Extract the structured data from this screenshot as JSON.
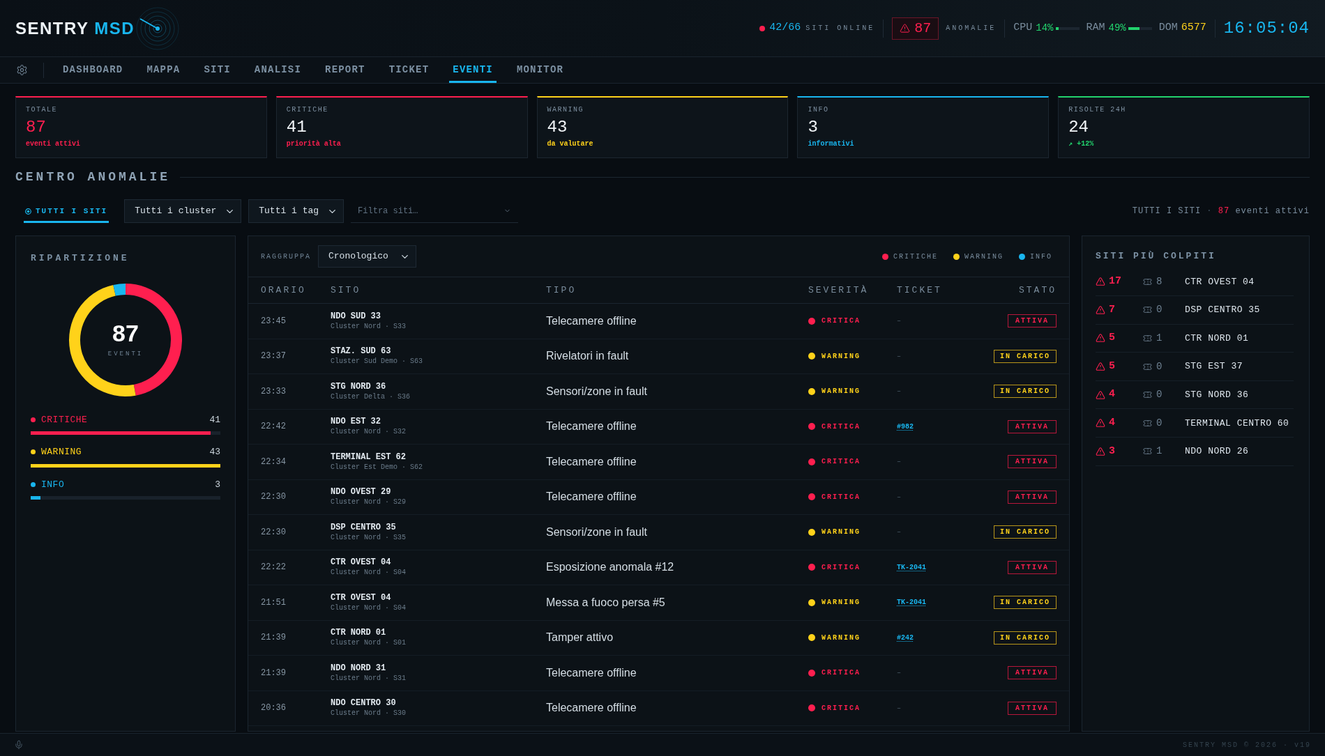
{
  "header": {
    "logo": {
      "name": "SENTRY",
      "accent": "MSD"
    },
    "sites_online": {
      "value": "42/66",
      "label": "SITI ONLINE"
    },
    "anomalies": {
      "value": "87",
      "label": "ANOMALIE"
    },
    "metrics": [
      {
        "kind": "gauge",
        "label": "CPU",
        "value": "14%",
        "level": 0.14
      },
      {
        "kind": "gauge",
        "label": "RAM",
        "value": "49%",
        "level": 0.49
      },
      {
        "kind": "count",
        "label": "DOM",
        "value": "6577"
      }
    ],
    "clock": "16:05:04"
  },
  "nav": {
    "tabs": [
      {
        "label": "DASHBOARD",
        "selected": false
      },
      {
        "label": "MAPPA",
        "selected": false
      },
      {
        "label": "SITI",
        "selected": false
      },
      {
        "label": "ANALISI",
        "selected": false
      },
      {
        "label": "REPORT",
        "selected": false
      },
      {
        "label": "TICKET",
        "selected": false
      },
      {
        "label": "EVENTI",
        "selected": true
      },
      {
        "label": "MONITOR",
        "selected": false
      }
    ]
  },
  "stat_cards": [
    {
      "kind": "total",
      "label": "TOTALE",
      "value": "87",
      "note": "eventi attivi",
      "color": "#ff1f4f"
    },
    {
      "kind": "count",
      "label": "CRITICHE",
      "value": "41",
      "note": "priorità alta",
      "color": "#ff1f4f"
    },
    {
      "kind": "count",
      "label": "WARNING",
      "value": "43",
      "note": "da valutare",
      "color": "#ffd21a"
    },
    {
      "kind": "count",
      "label": "INFO",
      "value": "3",
      "note": "informativi",
      "color": "#19b6ef"
    },
    {
      "kind": "count",
      "label": "RISOLTE 24H",
      "value": "24",
      "note": "↗ +12%",
      "color": "#22d36d"
    }
  ],
  "section_title": "CENTRO ANOMALIE",
  "filters": {
    "scope_tab": {
      "label": "TUTTI I SITI",
      "selected": true
    },
    "selects": [
      {
        "value": "Tutti i cluster"
      },
      {
        "value": "Tutti i tag"
      }
    ],
    "search": {
      "placeholder": "Filtra siti…"
    },
    "summary": {
      "scope": "TUTTI I SITI",
      "separator": "·",
      "count": "87",
      "text": "eventi attivi"
    }
  },
  "breakdown": {
    "title": "RIPARTIZIONE",
    "total": "87",
    "total_label": "EVENTI",
    "chart_data": {
      "type": "donut",
      "values": [
        47.1,
        49.4,
        3.5
      ]
    },
    "items": [
      {
        "label": "CRITICHE",
        "value": "41",
        "level": 0.95,
        "color": "#ff1f4f"
      },
      {
        "label": "WARNING",
        "value": "43",
        "level": 1.0,
        "color": "#ffd21a"
      },
      {
        "label": "INFO",
        "value": "3",
        "level": 0.05,
        "color": "#19b6ef"
      }
    ]
  },
  "events": {
    "group_label": "RAGGRUPPA",
    "group_select": "Cronologico",
    "legend": [
      {
        "label": "CRITICHE",
        "color": "#ff1f4f"
      },
      {
        "label": "WARNING",
        "color": "#ffd21a"
      },
      {
        "label": "INFO",
        "color": "#19b6ef"
      }
    ],
    "columns": [
      "ORARIO",
      "SITO",
      "TIPO",
      "SEVERITÀ",
      "TICKET",
      "STATO"
    ],
    "rows": [
      {
        "time": "23:45",
        "site": "NDO SUD 33",
        "cluster": "Cluster Nord · S33",
        "type": "Telecamere offline",
        "severity": {
          "kind": "critical",
          "label": "CRITICA"
        },
        "ticket": {
          "kind": "none",
          "label": "–"
        },
        "status": {
          "kind": "active",
          "label": "ATTIVA"
        }
      },
      {
        "time": "23:37",
        "site": "STAZ. SUD 63",
        "cluster": "Cluster Sud Demo · S63",
        "type": "Rivelatori in fault",
        "severity": {
          "kind": "warning",
          "label": "WARNING"
        },
        "ticket": {
          "kind": "none",
          "label": "–"
        },
        "status": {
          "kind": "in_progress",
          "label": "IN CARICO"
        }
      },
      {
        "time": "23:33",
        "site": "STG NORD 36",
        "cluster": "Cluster Delta · S36",
        "type": "Sensori/zone in fault",
        "severity": {
          "kind": "warning",
          "label": "WARNING"
        },
        "ticket": {
          "kind": "none",
          "label": "–"
        },
        "status": {
          "kind": "in_progress",
          "label": "IN CARICO"
        }
      },
      {
        "time": "22:42",
        "site": "NDO EST 32",
        "cluster": "Cluster Nord · S32",
        "type": "Telecamere offline",
        "severity": {
          "kind": "critical",
          "label": "CRITICA"
        },
        "ticket": {
          "kind": "link",
          "label": "#982"
        },
        "status": {
          "kind": "active",
          "label": "ATTIVA"
        }
      },
      {
        "time": "22:34",
        "site": "TERMINAL EST 62",
        "cluster": "Cluster Est Demo · S62",
        "type": "Telecamere offline",
        "severity": {
          "kind": "critical",
          "label": "CRITICA"
        },
        "ticket": {
          "kind": "none",
          "label": "–"
        },
        "status": {
          "kind": "active",
          "label": "ATTIVA"
        }
      },
      {
        "time": "22:30",
        "site": "NDO OVEST 29",
        "cluster": "Cluster Nord · S29",
        "type": "Telecamere offline",
        "severity": {
          "kind": "critical",
          "label": "CRITICA"
        },
        "ticket": {
          "kind": "none",
          "label": "–"
        },
        "status": {
          "kind": "active",
          "label": "ATTIVA"
        }
      },
      {
        "time": "22:30",
        "site": "DSP CENTRO 35",
        "cluster": "Cluster Nord · S35",
        "type": "Sensori/zone in fault",
        "severity": {
          "kind": "warning",
          "label": "WARNING"
        },
        "ticket": {
          "kind": "none",
          "label": "–"
        },
        "status": {
          "kind": "in_progress",
          "label": "IN CARICO"
        }
      },
      {
        "time": "22:22",
        "site": "CTR OVEST 04",
        "cluster": "Cluster Nord · S04",
        "type": "Esposizione anomala #12",
        "severity": {
          "kind": "critical",
          "label": "CRITICA"
        },
        "ticket": {
          "kind": "link",
          "label": "TK-2041"
        },
        "status": {
          "kind": "active",
          "label": "ATTIVA"
        }
      },
      {
        "time": "21:51",
        "site": "CTR OVEST 04",
        "cluster": "Cluster Nord · S04",
        "type": "Messa a fuoco persa #5",
        "severity": {
          "kind": "warning",
          "label": "WARNING"
        },
        "ticket": {
          "kind": "link",
          "label": "TK-2041"
        },
        "status": {
          "kind": "in_progress",
          "label": "IN CARICO"
        }
      },
      {
        "time": "21:39",
        "site": "CTR NORD 01",
        "cluster": "Cluster Nord · S01",
        "type": "Tamper attivo",
        "severity": {
          "kind": "warning",
          "label": "WARNING"
        },
        "ticket": {
          "kind": "link",
          "label": "#242"
        },
        "status": {
          "kind": "in_progress",
          "label": "IN CARICO"
        }
      },
      {
        "time": "21:39",
        "site": "NDO NORD 31",
        "cluster": "Cluster Nord · S31",
        "type": "Telecamere offline",
        "severity": {
          "kind": "critical",
          "label": "CRITICA"
        },
        "ticket": {
          "kind": "none",
          "label": "–"
        },
        "status": {
          "kind": "active",
          "label": "ATTIVA"
        }
      },
      {
        "time": "20:36",
        "site": "NDO CENTRO 30",
        "cluster": "Cluster Nord · S30",
        "type": "Telecamere offline",
        "severity": {
          "kind": "critical",
          "label": "CRITICA"
        },
        "ticket": {
          "kind": "none",
          "label": "–"
        },
        "status": {
          "kind": "active",
          "label": "ATTIVA"
        }
      }
    ]
  },
  "top_sites": {
    "title": "SITI PIÙ COLPITI",
    "rows": [
      {
        "anomalies": "17",
        "tickets": "8",
        "site": "CTR OVEST 04"
      },
      {
        "anomalies": "7",
        "tickets": "0",
        "site": "DSP CENTRO 35"
      },
      {
        "anomalies": "5",
        "tickets": "1",
        "site": "CTR NORD 01"
      },
      {
        "anomalies": "5",
        "tickets": "0",
        "site": "STG EST 37"
      },
      {
        "anomalies": "4",
        "tickets": "0",
        "site": "STG NORD 36"
      },
      {
        "anomalies": "4",
        "tickets": "0",
        "site": "TERMINAL CENTRO 60"
      },
      {
        "anomalies": "3",
        "tickets": "1",
        "site": "NDO NORD 26"
      }
    ]
  },
  "footer": {
    "text": "SENTRY MSD © 2026 · v19"
  }
}
